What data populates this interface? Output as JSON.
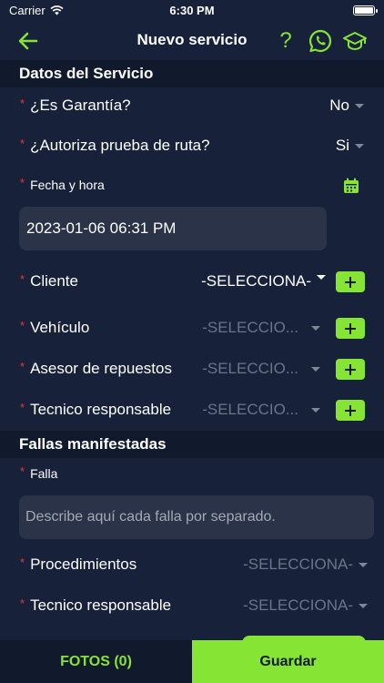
{
  "status_bar": {
    "carrier": "Carrier",
    "time": "6:30 PM"
  },
  "nav": {
    "title": "Nuevo servicio",
    "help_glyph": "?"
  },
  "icons": {
    "back": "arrow-left-icon",
    "help": "question-icon",
    "whatsapp": "whatsapp-icon",
    "cap": "graduation-cap-icon",
    "calendar": "calendar-icon",
    "add": "plus-icon"
  },
  "colors": {
    "accent": "#86e534",
    "background": "#17213a",
    "section": "#111a2c",
    "required": "#e53935",
    "field": "#2a3347"
  },
  "sections": {
    "service_data": "Datos del Servicio",
    "faults": "Fallas manifestadas"
  },
  "fields": {
    "es_garantia": {
      "label": "¿Es Garantía?",
      "value": "No"
    },
    "prueba_ruta": {
      "label": "¿Autoriza prueba de ruta?",
      "value": "Si"
    },
    "fecha_hora": {
      "label": "Fecha y hora",
      "value": "2023-01-06 06:31 PM"
    },
    "cliente": {
      "label": "Cliente",
      "value": "-SELECCIONA-"
    },
    "vehiculo": {
      "label": "Vehículo",
      "value": "-SELECCIO..."
    },
    "asesor": {
      "label": "Asesor de repuestos",
      "value": "-SELECCIO..."
    },
    "tecnico": {
      "label": "Tecnico responsable",
      "value": "-SELECCIO..."
    },
    "falla": {
      "label": "Falla",
      "placeholder": "Describe aquí cada falla por separado."
    },
    "procedimientos": {
      "label": "Procedimientos",
      "value": "-SELECCIONA-"
    },
    "tecnico2": {
      "label": "Tecnico responsable",
      "value": "-SELECCIONA-"
    }
  },
  "required_mark": "*",
  "bottom": {
    "fotos_label": "FOTOS (0)",
    "guardar_label": "Guardar"
  }
}
